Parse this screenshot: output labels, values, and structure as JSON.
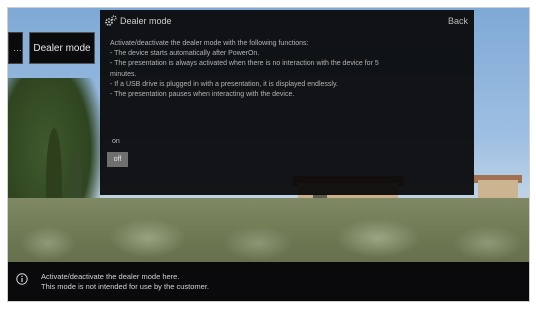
{
  "sidebar": {
    "stub_glyph": "…",
    "current_item": "Dealer mode"
  },
  "dialog": {
    "title": "Dealer mode",
    "back_label": "Back",
    "description": [
      "Activate/deactivate the dealer mode with the following functions:",
      "- The device starts automatically after PowerOn.",
      "- The presentation is always activated when there is no interaction with the device for 5",
      "minutes.",
      "- If a USB drive is plugged in with a presentation, it is displayed endlessly.",
      "- The presentation pauses when interacting with the device."
    ],
    "options": [
      "on",
      "off"
    ],
    "selected_option": "off"
  },
  "info_bar": {
    "line1": "Activate/deactivate the dealer mode here.",
    "line2": "This mode is not intended for use by the customer."
  },
  "icons": {
    "title_icon": "gear-icon",
    "info_icon": "info-icon"
  }
}
